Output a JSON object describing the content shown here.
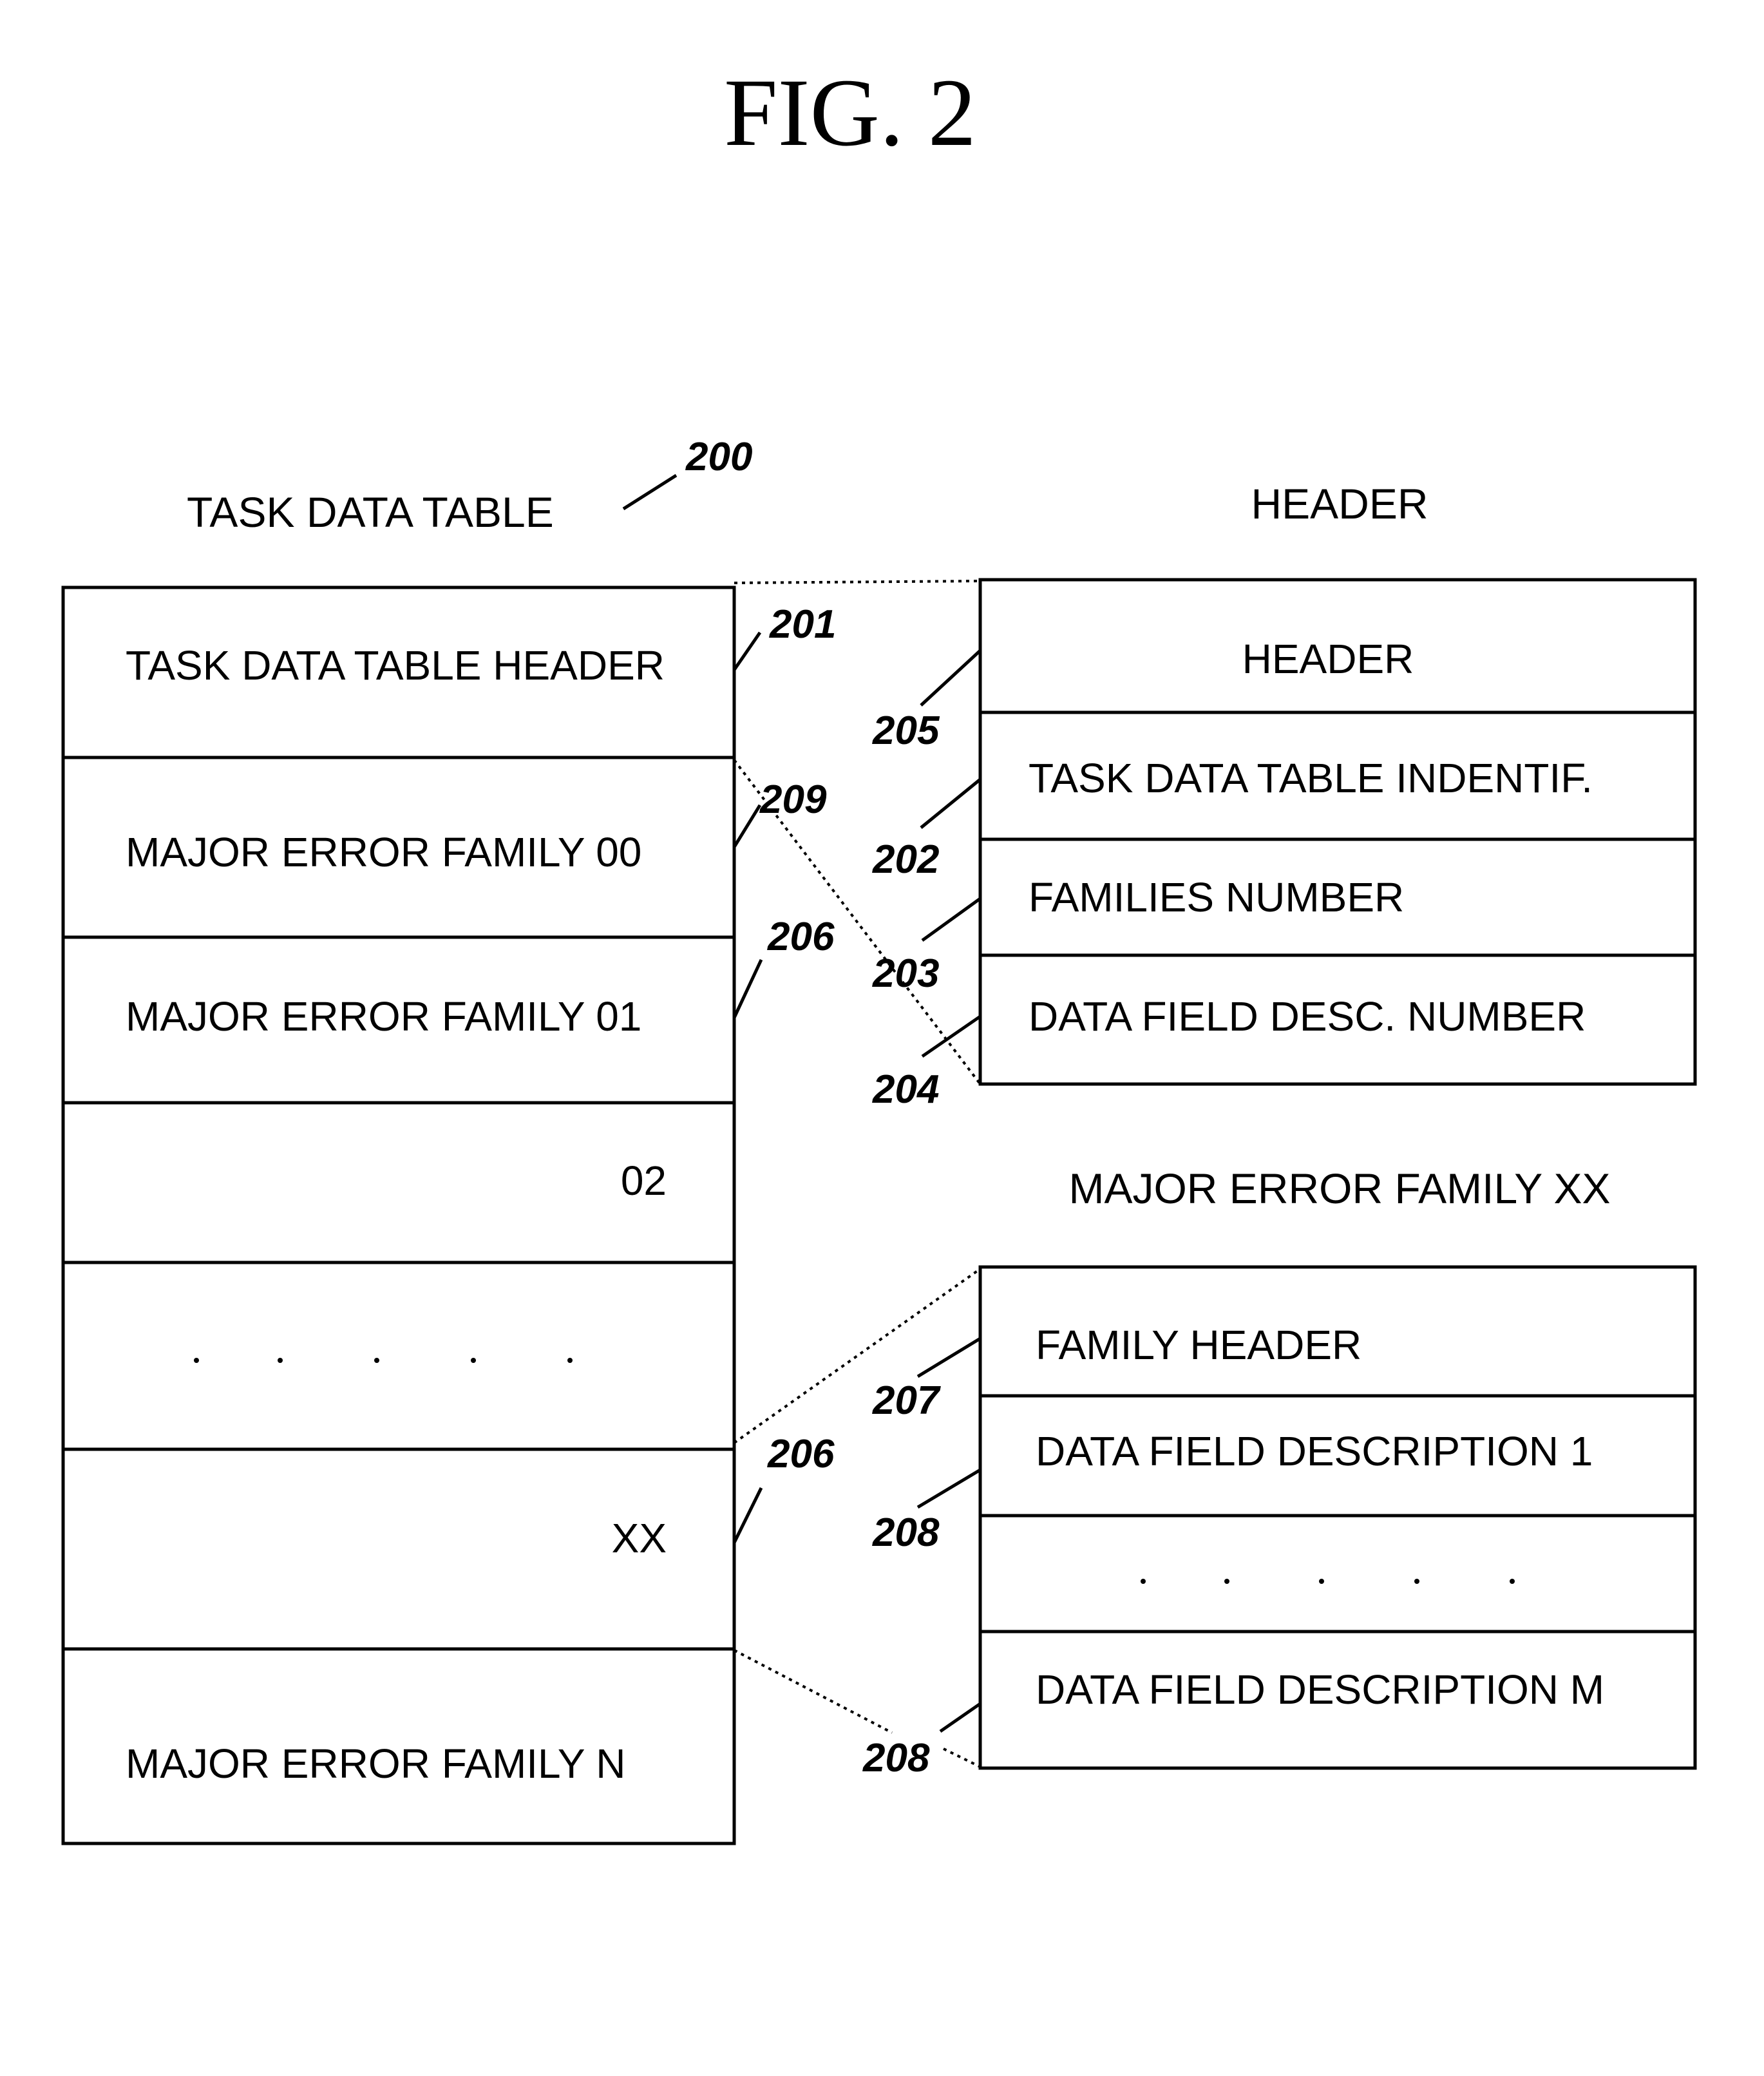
{
  "figure": {
    "title": "FIG. 2"
  },
  "task_data_table": {
    "caption": "TASK DATA TABLE",
    "ref": "200",
    "rows": [
      {
        "text": "TASK DATA TABLE HEADER",
        "ref": "201"
      },
      {
        "text": "MAJOR ERROR FAMILY 00",
        "ref": "209"
      },
      {
        "text": "MAJOR ERROR FAMILY 01",
        "ref": "206"
      },
      {
        "text": "02",
        "ref": ""
      },
      {
        "text": ". . . . .",
        "ref": ""
      },
      {
        "text": "XX",
        "ref": "206"
      },
      {
        "text": "MAJOR ERROR FAMILY N",
        "ref": ""
      }
    ]
  },
  "header_table": {
    "caption": "HEADER",
    "rows": [
      {
        "text": "HEADER",
        "ref": "205"
      },
      {
        "text": "TASK DATA TABLE INDENTIF.",
        "ref": "202"
      },
      {
        "text": "FAMILIES NUMBER",
        "ref": "203"
      },
      {
        "text": "DATA FIELD DESC. NUMBER",
        "ref": "204"
      }
    ]
  },
  "family_table": {
    "caption": "MAJOR ERROR FAMILY XX",
    "rows": [
      {
        "text": "FAMILY HEADER",
        "ref": "207"
      },
      {
        "text": "DATA FIELD DESCRIPTION 1",
        "ref": "208"
      },
      {
        "text": ". . . . .",
        "ref": ""
      },
      {
        "text": "DATA FIELD DESCRIPTION M",
        "ref": "208"
      }
    ]
  }
}
